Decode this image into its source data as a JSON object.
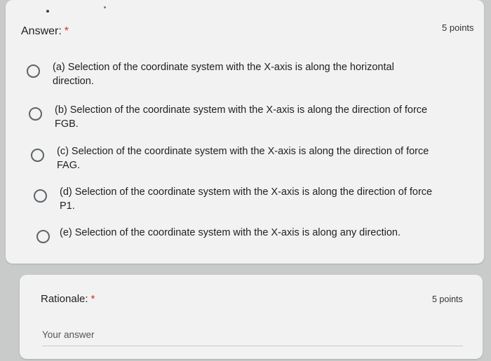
{
  "answer_question": {
    "title": "Answer:",
    "required_mark": "*",
    "points": "5 points",
    "options": [
      {
        "label": "(a) Selection of the coordinate system with the X-axis is along the horizontal\ndirection."
      },
      {
        "label": "(b) Selection of the coordinate system with the X-axis is along the direction of force\nFGB."
      },
      {
        "label": "(c) Selection of the coordinate system with the X-axis is along the direction of force\nFAG."
      },
      {
        "label": "(d) Selection of the coordinate system with the X-axis is along the direction of force\nP1."
      },
      {
        "label": "(e) Selection of the coordinate system with the X-axis is along any direction."
      }
    ]
  },
  "rationale_question": {
    "title": "Rationale:",
    "required_mark": "*",
    "points": "5 points",
    "input_placeholder": "Your answer",
    "input_value": ""
  },
  "colors": {
    "required": "#d93025",
    "card_background": "#f1f2f1",
    "page_background": "#c9cbcb"
  }
}
